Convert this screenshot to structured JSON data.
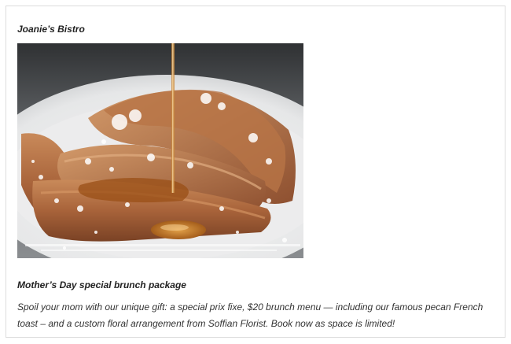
{
  "post": {
    "restaurant_name": "Joanie’s Bistro",
    "image_subject": "french-toast-with-syrup-photo",
    "offer_title": "Mother’s Day special brunch package",
    "offer_description": "Spoil your mom with our unique gift: a special prix fixe, $20 brunch menu — including our famous pecan French toast – and a custom floral arrangement from Soffian Florist. Book now as space is limited!"
  },
  "colors": {
    "card_border": "#dcdcdc",
    "text": "#222222",
    "body_text": "#333333"
  }
}
